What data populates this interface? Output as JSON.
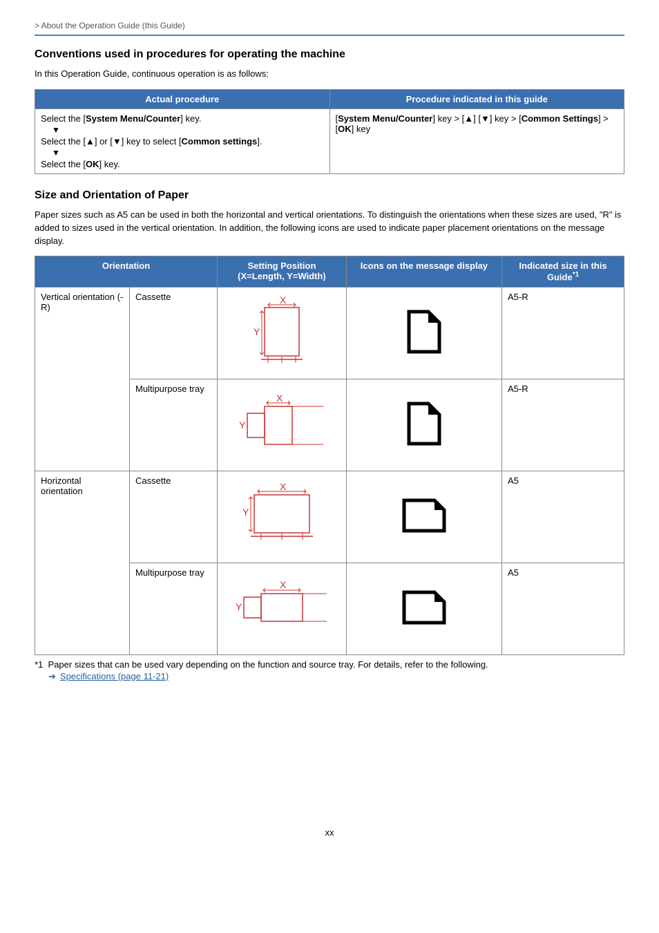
{
  "breadcrumb": " > About the Operation Guide (this Guide)",
  "section1": {
    "heading": "Conventions used in procedures for operating the machine",
    "intro": "In this Operation Guide, continuous operation is as follows:",
    "table": {
      "th1": "Actual procedure",
      "th2": "Procedure indicated in this guide",
      "left": {
        "l1a": "Select the [",
        "l1b": "System Menu/Counter",
        "l1c": "] key.",
        "l2a": "Select the [▲] or [▼] key to select [",
        "l2b": "Common settings",
        "l2c": "].",
        "l3a": "Select the [",
        "l3b": "OK",
        "l3c": "] key."
      },
      "right": {
        "r1": "[",
        "r2": "System Menu/Counter",
        "r3": "] key > [▲] [▼] key > [",
        "r4": "Common Settings",
        "r5": "] > [",
        "r6": "OK",
        "r7": "] key"
      }
    }
  },
  "section2": {
    "heading": "Size and Orientation of Paper",
    "intro": "Paper sizes such as A5 can be used in both the horizontal and vertical orientations. To distinguish the orientations when these sizes are used, \"R\" is added to sizes used in the vertical orientation. In addition, the following icons are used to indicate paper placement orientations on the message display.",
    "table": {
      "th1": "Orientation",
      "th2": "Setting Position",
      "th2sub": "(X=Length, Y=Width)",
      "th3": "Icons on the message display",
      "th4": "Indicated size in this Guide",
      "row1": {
        "orient": "Vertical orientation (-R)",
        "src": "Cassette",
        "size": "A5-R"
      },
      "row2": {
        "src": "Multipurpose tray",
        "size": "A5-R"
      },
      "row3": {
        "orient": "Horizontal orientation",
        "src": "Cassette",
        "size": "A5"
      },
      "row4": {
        "src": "Multipurpose tray",
        "size": "A5"
      }
    },
    "footnote_label": "*1",
    "footnote_text": "Paper sizes that can be used vary depending on the function and source tray. For details, refer to the following.",
    "link": "Specifications (page 11-21)"
  },
  "pagenum": "xx",
  "sup1": "*1"
}
